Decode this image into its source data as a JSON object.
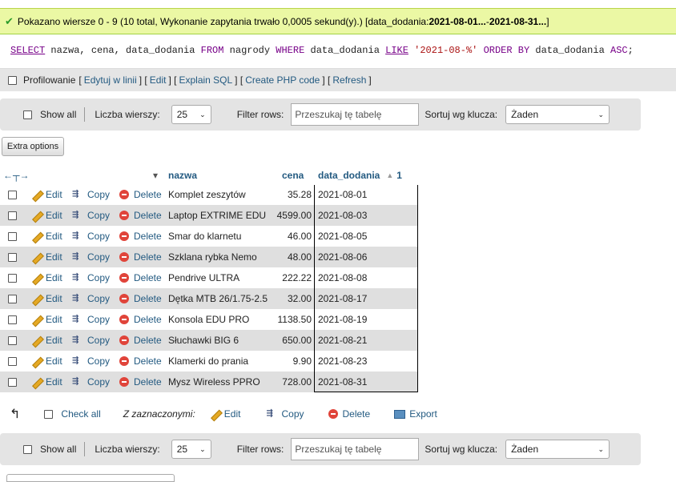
{
  "message": {
    "prefix": "Pokazano wiersze 0 - 9 (10 total, Wykonanie zapytania trwało 0,0005 sekund(y).) [data_dodania: ",
    "range_from": "2021-08-01...",
    "range_sep": " - ",
    "range_to": "2021-08-31...",
    "suffix": "]"
  },
  "sql": {
    "select": "SELECT",
    "p1": " nazwa, cena, data_dodania ",
    "from": "FROM",
    "p2": " nagrody ",
    "where": "WHERE",
    "p3": " data_dodania ",
    "like": "LIKE",
    "p4": " ",
    "str": "'2021-08-%'",
    "p5": " ",
    "orderby": "ORDER BY",
    "p6": " data_dodania ",
    "asc": "ASC",
    "p7": ";"
  },
  "sql_links": {
    "profiling": "Profilowanie",
    "edit_inline": "Edytuj w linii",
    "edit": "Edit",
    "explain": "Explain SQL",
    "create_php": "Create PHP code",
    "refresh": "Refresh"
  },
  "navbar": {
    "show_all": "Show all",
    "rows_label": "Liczba wierszy:",
    "rows_value": "25",
    "filter_label": "Filter rows:",
    "filter_placeholder": "Przeszukaj tę tabelę",
    "sort_label": "Sortuj wg klucza:",
    "sort_value": "Żaden"
  },
  "extra_options": "Extra options",
  "columns": {
    "nazwa": "nazwa",
    "cena": "cena",
    "data_dodania": "data_dodania",
    "sort_order": "1"
  },
  "actions": {
    "edit": "Edit",
    "copy": "Copy",
    "delete": "Delete"
  },
  "rows": [
    {
      "nazwa": "Komplet zeszytów",
      "cena": "35.28",
      "data": "2021-08-01"
    },
    {
      "nazwa": "Laptop EXTRIME EDU",
      "cena": "4599.00",
      "data": "2021-08-03"
    },
    {
      "nazwa": "Smar do klarnetu",
      "cena": "46.00",
      "data": "2021-08-05"
    },
    {
      "nazwa": "Szklana rybka Nemo",
      "cena": "48.00",
      "data": "2021-08-06"
    },
    {
      "nazwa": "Pendrive ULTRA",
      "cena": "222.22",
      "data": "2021-08-08"
    },
    {
      "nazwa": "Dętka MTB 26/1.75-2.5",
      "cena": "32.00",
      "data": "2021-08-17"
    },
    {
      "nazwa": "Konsola EDU PRO",
      "cena": "1138.50",
      "data": "2021-08-19"
    },
    {
      "nazwa": "Słuchawki BIG 6",
      "cena": "650.00",
      "data": "2021-08-21"
    },
    {
      "nazwa": "Klamerki do prania",
      "cena": "9.90",
      "data": "2021-08-23"
    },
    {
      "nazwa": "Mysz Wireless PPRO",
      "cena": "728.00",
      "data": "2021-08-31"
    }
  ],
  "bulk": {
    "check_all": "Check all",
    "with_selected": "Z zaznaczonymi:",
    "edit": "Edit",
    "copy": "Copy",
    "delete": "Delete",
    "export": "Export"
  },
  "colors": {
    "link": "#235a81",
    "success_bg": "#ebf8a4",
    "row_alt": "#dfdfdf"
  }
}
